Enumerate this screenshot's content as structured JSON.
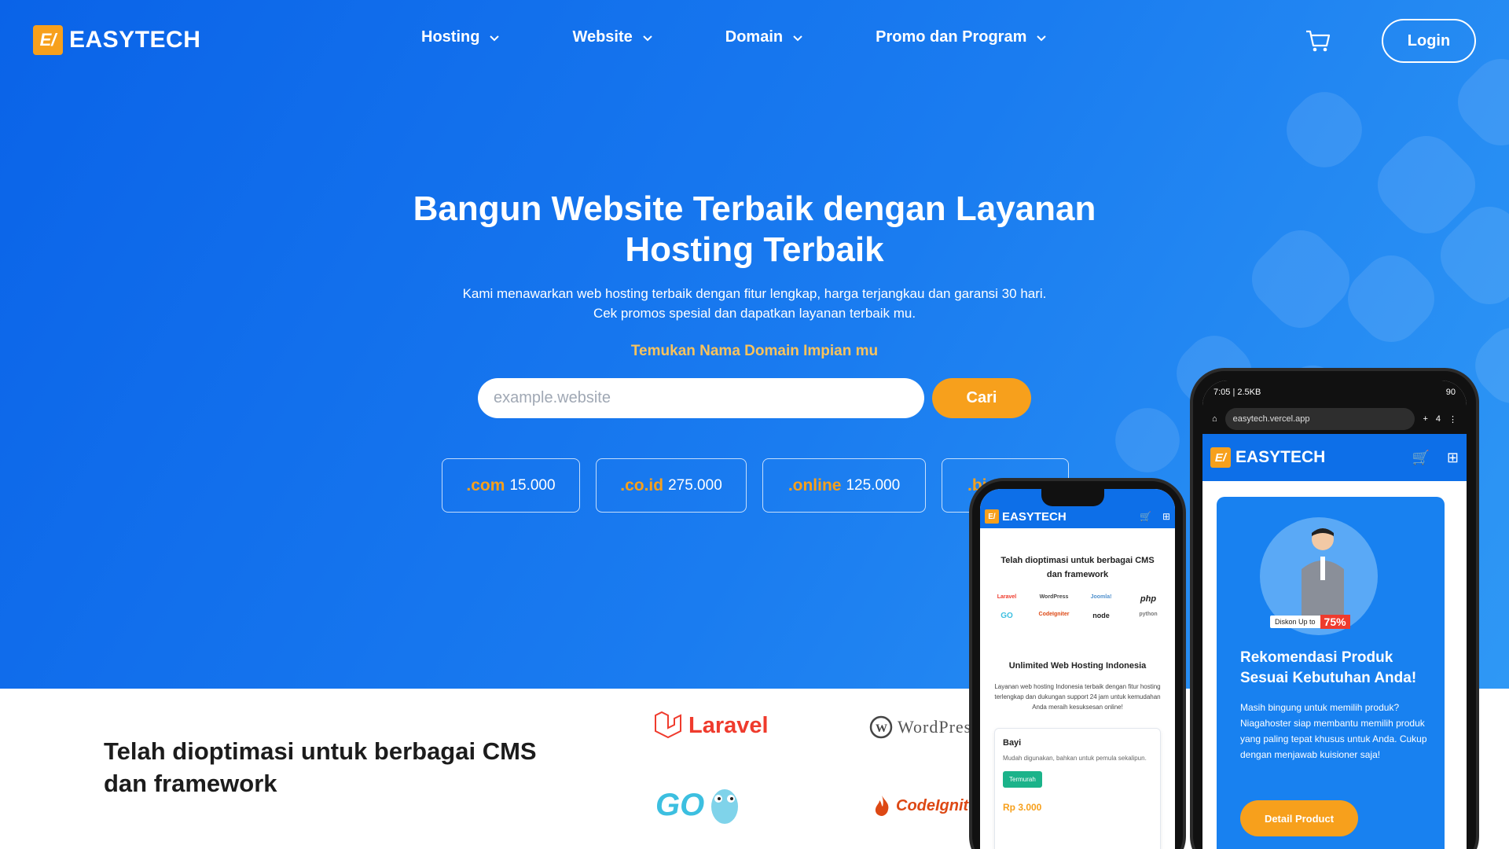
{
  "brand": {
    "name": "EASYTECH",
    "mark": "E/"
  },
  "nav": {
    "items": [
      {
        "label": "Hosting"
      },
      {
        "label": "Website"
      },
      {
        "label": "Domain"
      },
      {
        "label": "Promo dan Program"
      }
    ],
    "login_label": "Login"
  },
  "hero": {
    "headline": "Bangun Website Terbaik dengan Layanan Hosting Terbaik",
    "subtext": "Kami menawarkan web hosting terbaik dengan fitur lengkap, harga terjangkau dan garansi 30 hari. Cek promos spesial dan dapatkan layanan terbaik mu.",
    "domain_title": "Temukan Nama Domain Impian mu",
    "search_placeholder": "example.website",
    "search_button": "Cari",
    "tlds": [
      {
        "name": ".com",
        "price": "15.000"
      },
      {
        "name": ".co.id",
        "price": "275.000"
      },
      {
        "name": ".online",
        "price": "125.000"
      },
      {
        "name": ".bi",
        "price": ""
      }
    ]
  },
  "cms_section": {
    "heading": "Telah dioptimasi untuk berbagai CMS dan framework",
    "logos": [
      "Laravel",
      "WordPress",
      "GO",
      "CodeIgniter"
    ]
  },
  "phone_large": {
    "status_time": "7:05 | 2.5KB",
    "status_battery": "90",
    "url": "easytech.vercel.app",
    "tab_count": "4",
    "discount_label": "Diskon Up to",
    "discount_value": "75%",
    "promo_title": "Rekomendasi Produk Sesuai Kebutuhan Anda!",
    "promo_text": "Masih bingung untuk memilih produk? Niagahoster siap membantu memilih produk yang paling tepat khusus untuk Anda. Cukup dengan menjawab kuisioner saja!",
    "promo_button": "Detail Product"
  },
  "phone_small": {
    "title": "Telah dioptimasi untuk berbagai CMS dan framework",
    "logos": [
      "Laravel",
      "WordPress",
      "Joomla!",
      "php",
      "GO",
      "CodeIgniter",
      "node",
      "python"
    ],
    "title2": "Unlimited Web Hosting Indonesia",
    "text": "Layanan web hosting Indonesia terbaik dengan fitur hosting terlengkap dan dukungan support 24 jam untuk kemudahan Anda meraih kesuksesan online!",
    "card_title": "Bayi",
    "card_desc": "Mudah digunakan, bahkan untuk pemula sekalipun.",
    "card_badge": "Termurah",
    "card_price": "Rp 3.000"
  },
  "colors": {
    "primary": "#0d6fe8",
    "accent": "#f7a01c",
    "highlight": "#f9c35c"
  }
}
